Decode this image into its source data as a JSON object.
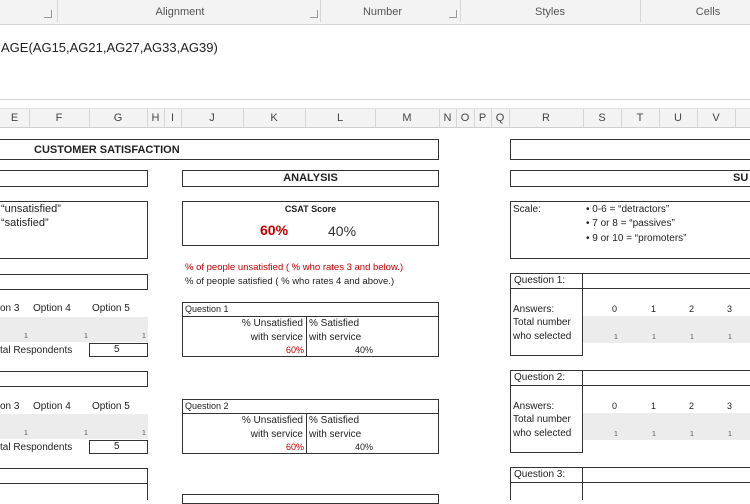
{
  "ribbon": {
    "groups": [
      "Alignment",
      "Number",
      "Styles",
      "Cells"
    ]
  },
  "formula_bar": {
    "text": "AGE(AG15,AG21,AG27,AG33,AG39)"
  },
  "columns": [
    "E",
    "F",
    "G",
    "H",
    "I",
    "J",
    "K",
    "L",
    "M",
    "N",
    "O",
    "P",
    "Q",
    "R",
    "S",
    "T",
    "U",
    "V"
  ],
  "left": {
    "title": "CUSTOMER SATISFACTION",
    "legend_unsat": "“unsatisfied”",
    "legend_sat": "“satisfied”",
    "options": [
      "on 3",
      "Option 4",
      "Option 5"
    ],
    "ones": [
      "1",
      "1",
      "1"
    ],
    "total_label": "tal Respondents",
    "total_value": "5"
  },
  "analysis": {
    "title": "ANALYSIS",
    "csat_label": "CSAT Score",
    "csat_unsat": "60%",
    "csat_sat": "40%",
    "note_red": "% of people unsatisfied ( % who rates 3 and below.)",
    "note_black": "% of people satisfied ( % who rates 4 and above.)",
    "q1": {
      "label": "Question 1",
      "unsat_h1": "% Unsatisfied",
      "unsat_h2": "with service",
      "sat_h1": "% Satisfied",
      "sat_h2": "with service",
      "unsat_val": "60%",
      "sat_val": "40%"
    },
    "q2": {
      "label": "Question 2",
      "unsat_h1": "% Unsatisfied",
      "unsat_h2": "with service",
      "sat_h1": "% Satisfied",
      "sat_h2": "with service",
      "unsat_val": "60%",
      "sat_val": "40%"
    }
  },
  "right": {
    "title": "SU",
    "scale_label": "Scale:",
    "scale_items": [
      "0-6 = “detractors”",
      "7 or 8 = “passives”",
      "9 or 10 = “promoters”"
    ],
    "q1": "Question 1:",
    "q2": "Question 2:",
    "q3": "Question 3:",
    "answers_label": "Answers:",
    "total_label1": "Total number",
    "total_label2": "who selected",
    "answer_values": [
      "0",
      "1",
      "2",
      "3"
    ],
    "selected": [
      "1",
      "1",
      "1",
      "1"
    ]
  }
}
